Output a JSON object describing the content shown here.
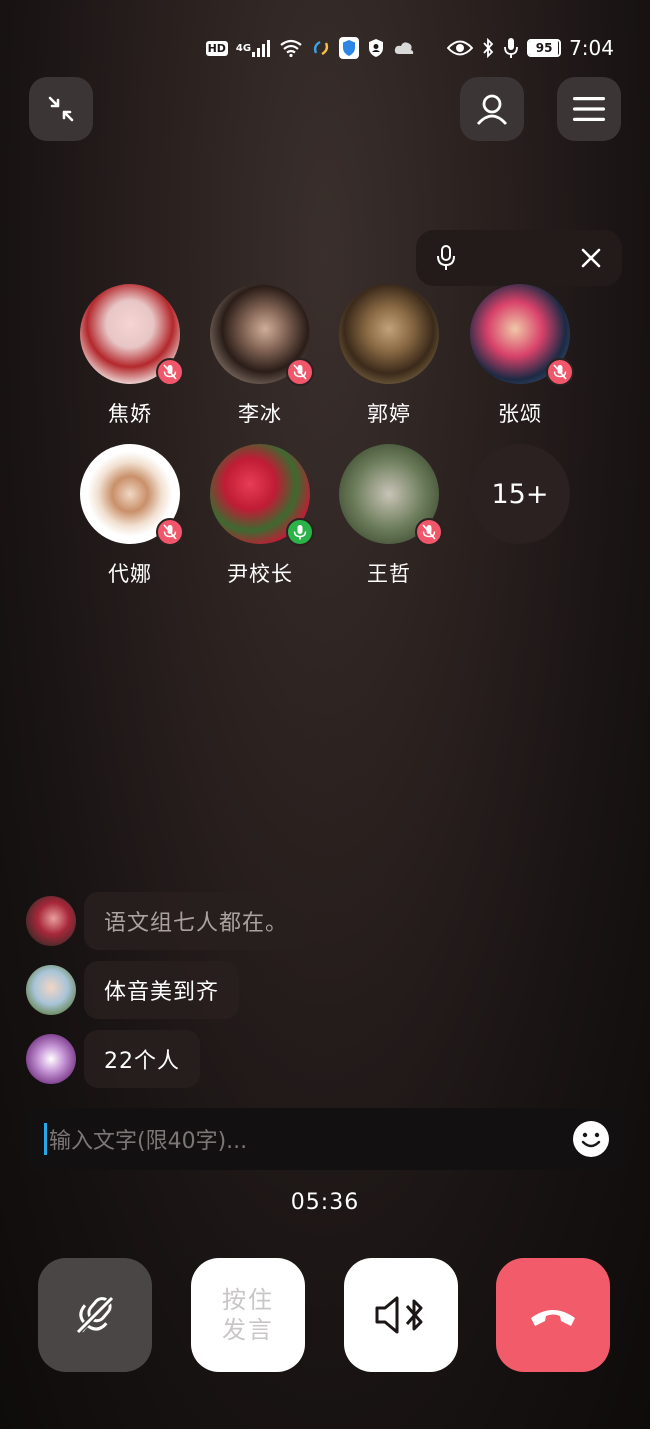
{
  "status_bar": {
    "network_badge": "HD",
    "network_type": "4G",
    "battery": "95",
    "time": "7:04",
    "icons": [
      "hd-icon",
      "signal-icon",
      "wifi-icon",
      "sync-icon",
      "shield-icon",
      "vpn-icon",
      "cloud-icon",
      "eye-icon",
      "bluetooth-icon",
      "microphone-icon",
      "battery-icon"
    ]
  },
  "participants": [
    {
      "name": "焦娇",
      "mic": "muted",
      "avatar_colors": [
        "#e8c6c6",
        "#b3282c",
        "#f2e9e6"
      ]
    },
    {
      "name": "李冰",
      "mic": "muted",
      "avatar_colors": [
        "#cfc1b6",
        "#2a1d18",
        "#a8968a"
      ]
    },
    {
      "name": "郭婷",
      "mic": "none",
      "avatar_colors": [
        "#6b5a3c",
        "#3b2a1a",
        "#a28a5c"
      ]
    },
    {
      "name": "张颂",
      "mic": "muted",
      "avatar_colors": [
        "#1c2a44",
        "#d8426a",
        "#4a6a8a"
      ]
    },
    {
      "name": "代娜",
      "mic": "muted",
      "avatar_colors": [
        "#ffffff",
        "#c9906a",
        "#f1e0d0"
      ]
    },
    {
      "name": "尹校长",
      "mic": "on",
      "avatar_colors": [
        "#c01c35",
        "#3d6a30",
        "#e73d55"
      ]
    },
    {
      "name": "王哲",
      "mic": "muted",
      "avatar_colors": [
        "#6b7c5a",
        "#c8c4b8",
        "#3c4a30"
      ]
    }
  ],
  "more_count": "15+",
  "chat": [
    {
      "text": "语文组七人都在。",
      "faded": true
    },
    {
      "text": "体音美到齐",
      "faded": false
    },
    {
      "text": "22个人",
      "faded": false
    }
  ],
  "input": {
    "placeholder": "输入文字(限40字)..."
  },
  "timer": "05:36",
  "controls": {
    "hold_to_talk": "按住发言"
  },
  "colors": {
    "hangup": "#f25b69",
    "mic_muted": "#f0576b",
    "mic_on": "#2bb34a",
    "caret": "#27a8e8"
  }
}
